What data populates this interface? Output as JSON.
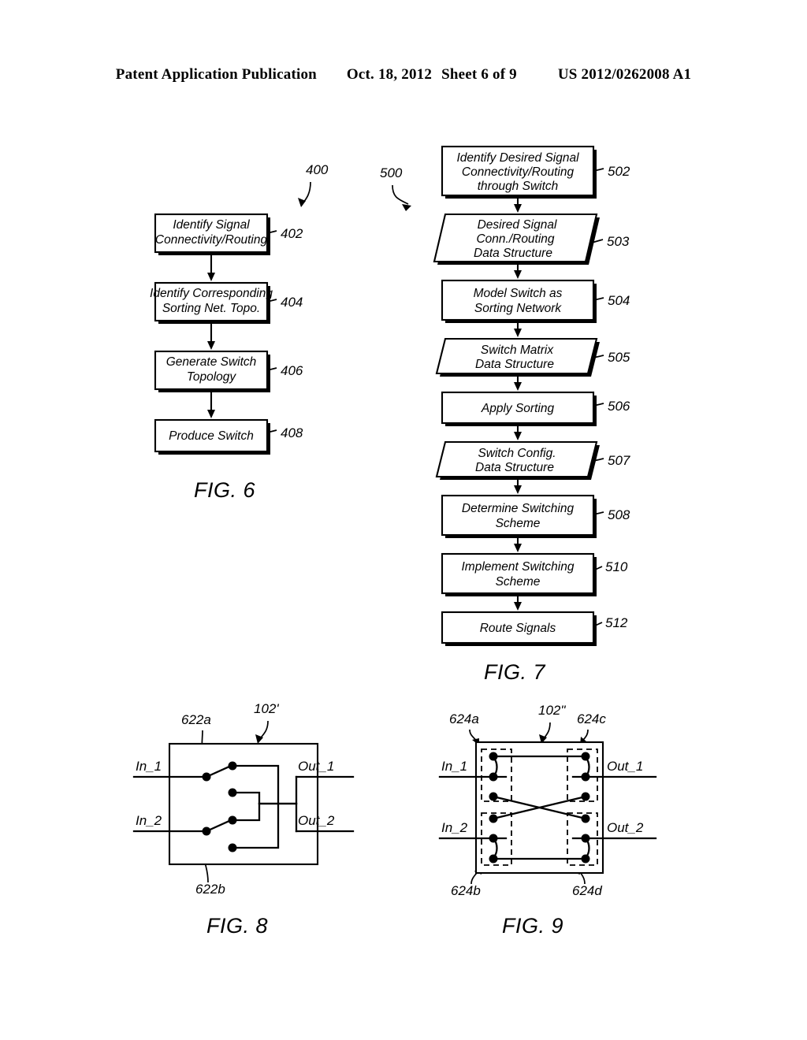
{
  "header": {
    "publication": "Patent Application Publication",
    "date": "Oct. 18, 2012",
    "sheet": "Sheet 6 of 9",
    "number": "US 2012/0262008 A1"
  },
  "fig6": {
    "caption": "FIG. 6",
    "flow_ref": "400",
    "steps": [
      {
        "ref": "402",
        "line1": "Identify Signal",
        "line2": "Connectivity/Routing"
      },
      {
        "ref": "404",
        "line1": "Identify Corresponding",
        "line2": "Sorting Net. Topo."
      },
      {
        "ref": "406",
        "line1": "Generate Switch",
        "line2": "Topology"
      },
      {
        "ref": "408",
        "line1": "Produce Switch",
        "line2": ""
      }
    ]
  },
  "fig7": {
    "caption": "FIG. 7",
    "flow_ref": "500",
    "steps": [
      {
        "ref": "502",
        "shape": "process",
        "line1": "Identify Desired Signal",
        "line2": "Connectivity/Routing",
        "line3": "through Switch"
      },
      {
        "ref": "503",
        "shape": "data",
        "line1": "Desired Signal",
        "line2": "Conn./Routing",
        "line3": "Data Structure"
      },
      {
        "ref": "504",
        "shape": "process",
        "line1": "Model Switch as",
        "line2": "Sorting Network",
        "line3": ""
      },
      {
        "ref": "505",
        "shape": "data",
        "line1": "Switch Matrix",
        "line2": "Data Structure",
        "line3": ""
      },
      {
        "ref": "506",
        "shape": "process",
        "line1": "Apply Sorting",
        "line2": "",
        "line3": ""
      },
      {
        "ref": "507",
        "shape": "data",
        "line1": "Switch Config.",
        "line2": "Data Structure",
        "line3": ""
      },
      {
        "ref": "508",
        "shape": "process",
        "line1": "Determine Switching",
        "line2": "Scheme",
        "line3": ""
      },
      {
        "ref": "510",
        "shape": "process",
        "line1": "Implement Switching",
        "line2": "Scheme",
        "line3": ""
      },
      {
        "ref": "512",
        "shape": "process",
        "line1": "Route Signals",
        "line2": "",
        "line3": ""
      }
    ]
  },
  "fig8": {
    "caption": "FIG. 8",
    "switch_ref": "102'",
    "switch_a_ref": "622a",
    "switch_b_ref": "622b",
    "in1": "In_1",
    "in2": "In_2",
    "out1": "Out_1",
    "out2": "Out_2"
  },
  "fig9": {
    "caption": "FIG. 9",
    "switch_ref": "102\"",
    "sw_a_ref": "624a",
    "sw_b_ref": "624b",
    "sw_c_ref": "624c",
    "sw_d_ref": "624d",
    "in1": "In_1",
    "in2": "In_2",
    "out1": "Out_1",
    "out2": "Out_2"
  }
}
